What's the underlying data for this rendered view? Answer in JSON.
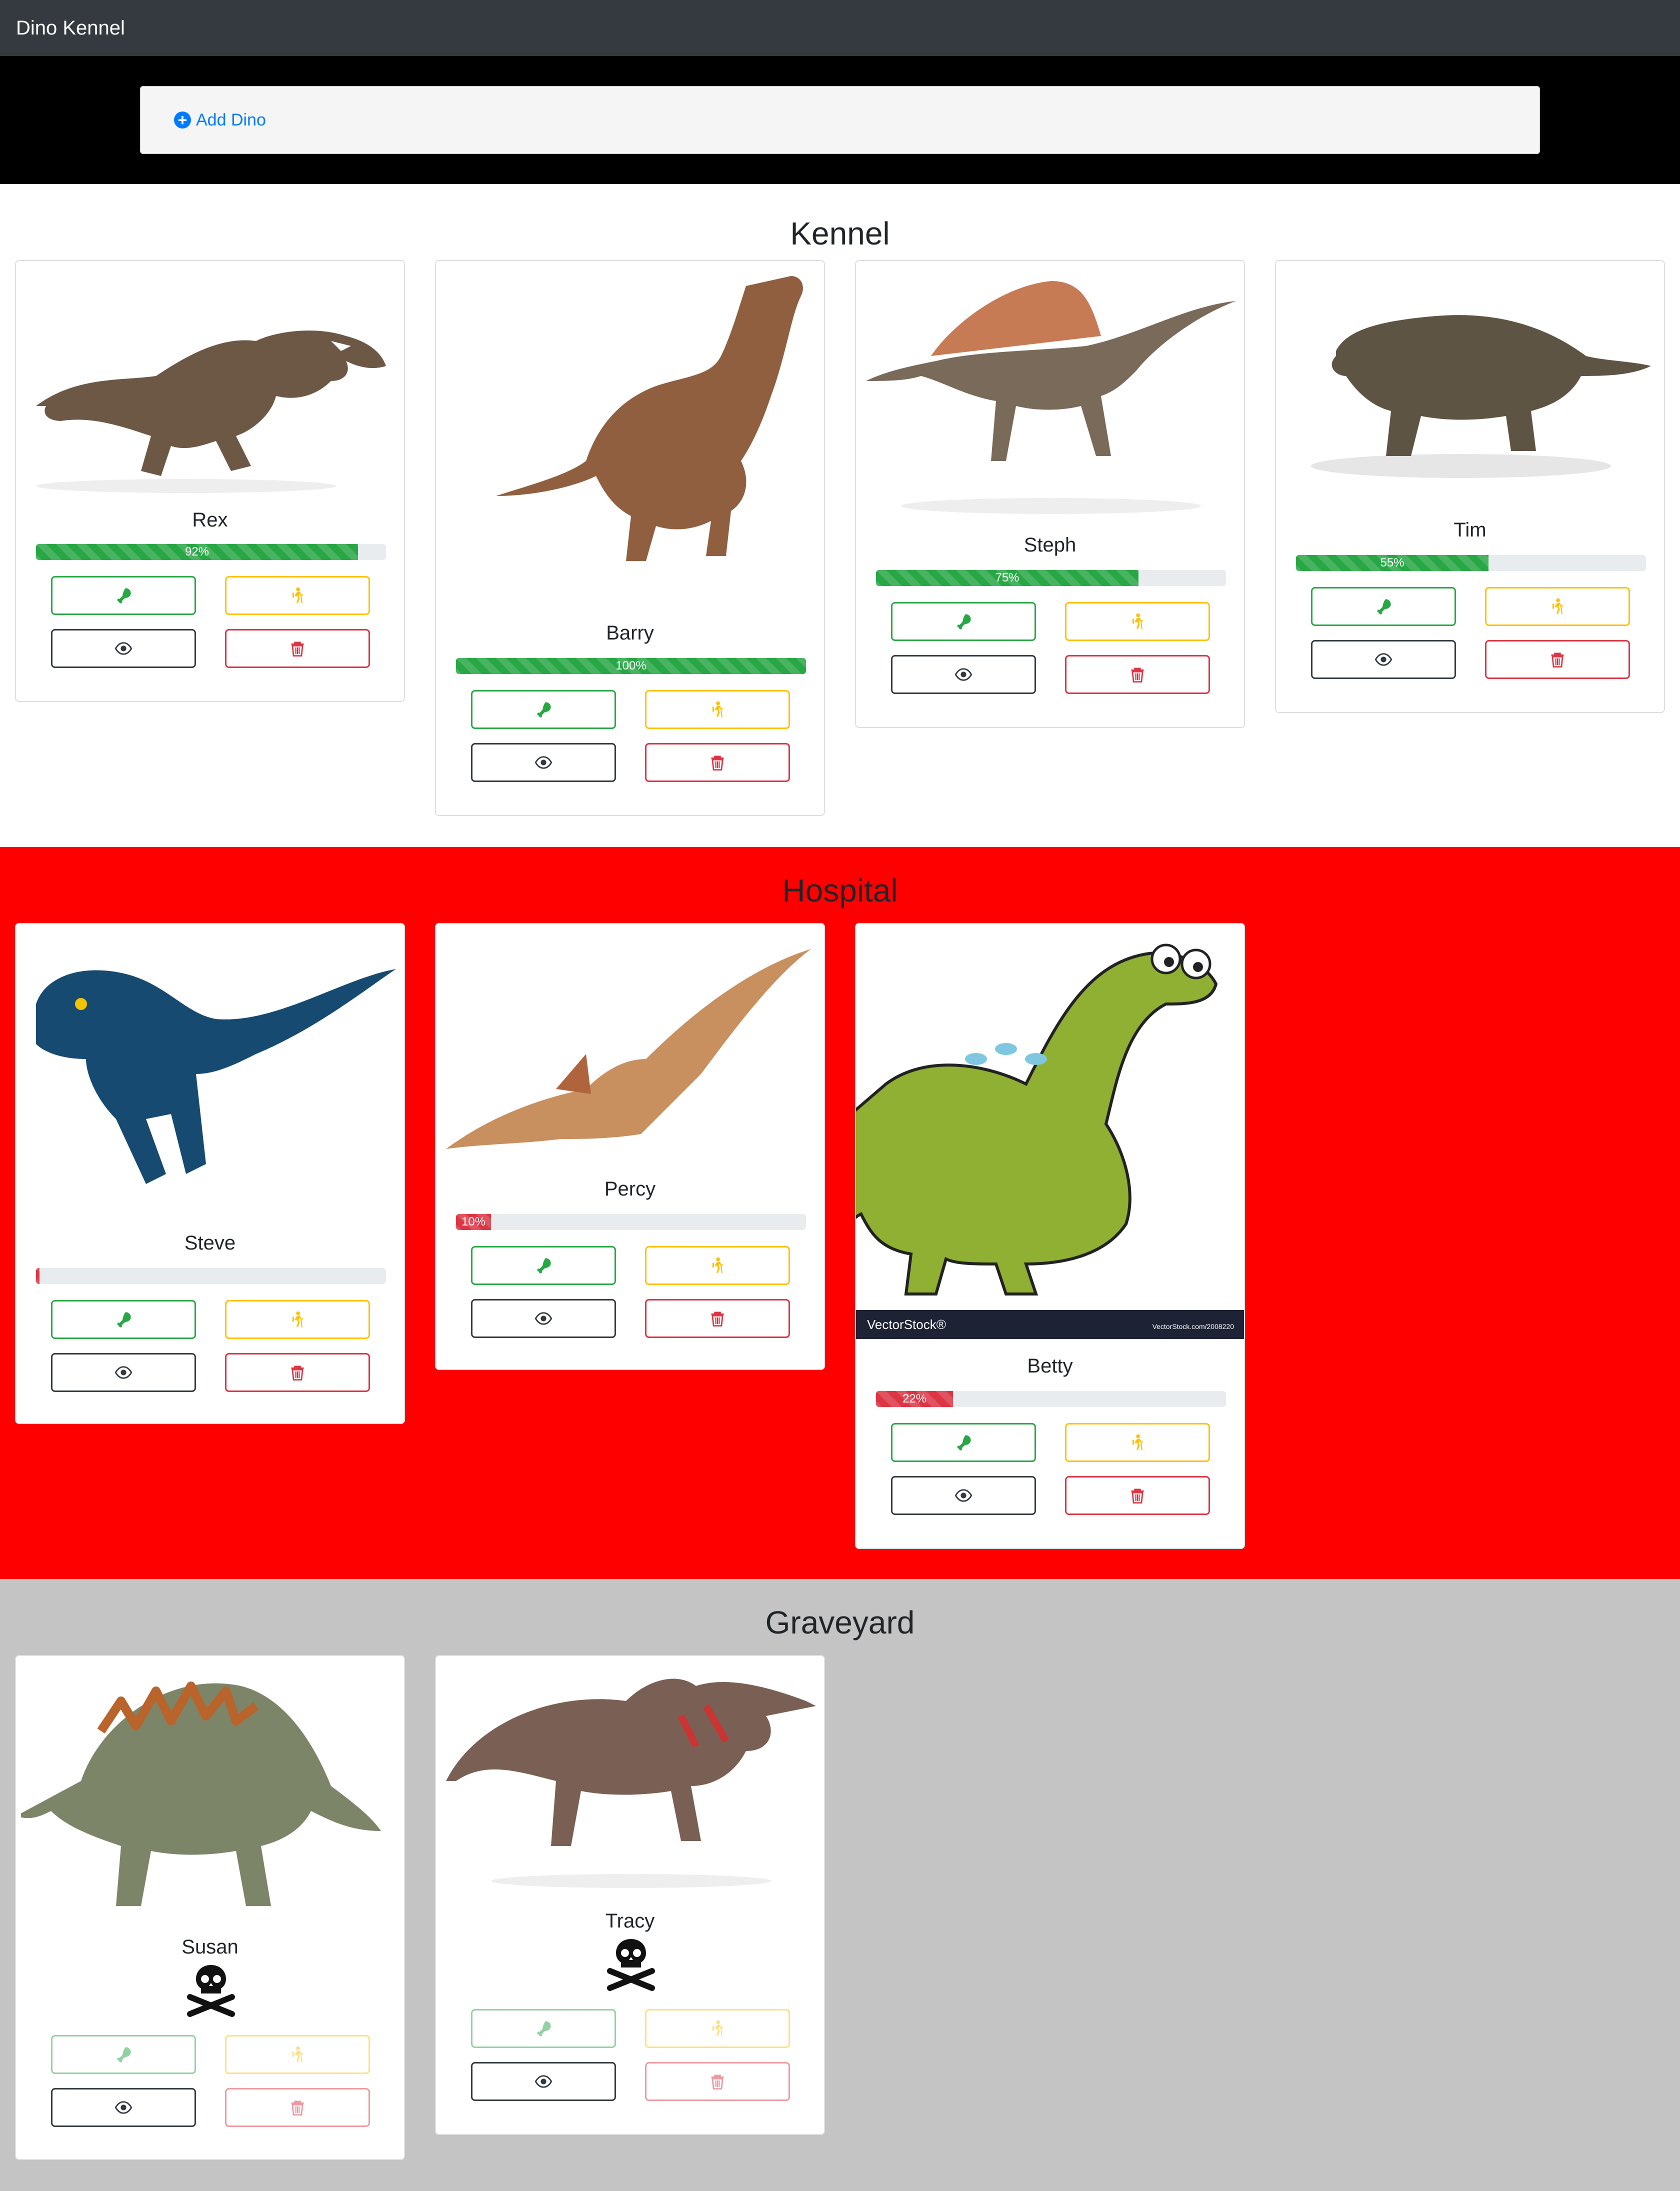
{
  "navbar": {
    "brand": "Dino Kennel"
  },
  "toolbar": {
    "add_label": "Add Dino",
    "add_icon": "plus-circle-icon"
  },
  "sections": {
    "kennel": {
      "title": "Kennel"
    },
    "hospital": {
      "title": "Hospital"
    },
    "graveyard": {
      "title": "Graveyard"
    }
  },
  "dinos": {
    "rex": {
      "name": "Rex",
      "health_percent": 92,
      "health_label": "92%",
      "bar_color": "#28a745"
    },
    "barry": {
      "name": "Barry",
      "health_percent": 100,
      "health_label": "100%",
      "bar_color": "#28a745"
    },
    "steph": {
      "name": "Steph",
      "health_percent": 75,
      "health_label": "75%",
      "bar_color": "#28a745"
    },
    "tim": {
      "name": "Tim",
      "health_percent": 55,
      "health_label": "55%",
      "bar_color": "#28a745"
    },
    "steve": {
      "name": "Steve",
      "health_percent": 1,
      "health_label": "",
      "bar_color": "#dc3545"
    },
    "percy": {
      "name": "Percy",
      "health_percent": 10,
      "health_label": "10%",
      "bar_color": "#dc3545"
    },
    "betty": {
      "name": "Betty",
      "health_percent": 22,
      "health_label": "22%",
      "bar_color": "#dc3545",
      "watermark_brand": "VectorStock®",
      "watermark_url": "VectorStock.com/2008220"
    },
    "susan": {
      "name": "Susan",
      "status_icon": "skull-crossbones-icon"
    },
    "tracy": {
      "name": "Tracy",
      "status_icon": "skull-crossbones-icon"
    }
  },
  "actions": {
    "feed_icon": "drumstick-icon",
    "walk_icon": "hiking-icon",
    "view_icon": "eye-icon",
    "delete_icon": "trash-icon"
  },
  "colors": {
    "navbar": "#343a40",
    "hospital_bg": "#ff0000",
    "graveyard_bg": "#c4c4c4",
    "success": "#28a745",
    "warning": "#ffc107",
    "danger": "#dc3545",
    "link": "#007bff"
  }
}
